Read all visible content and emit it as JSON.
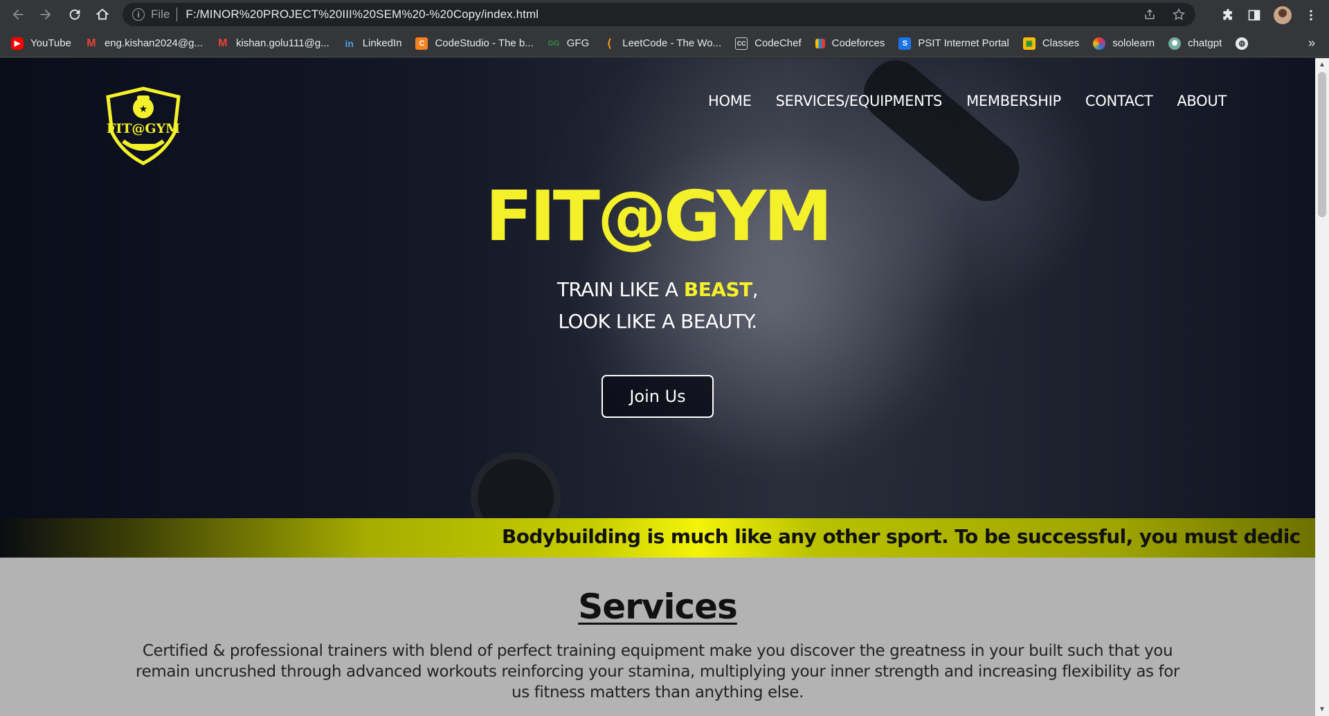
{
  "browser": {
    "file_label": "File",
    "url": "F:/MINOR%20PROJECT%20III%20SEM%20-%20Copy/index.html",
    "bookmarks": [
      {
        "label": "YouTube",
        "icon": "youtube-icon",
        "color": "#ff0000"
      },
      {
        "label": "eng.kishan2024@g...",
        "icon": "gmail-icon",
        "color": "#ea4335"
      },
      {
        "label": "kishan.golu111@g...",
        "icon": "gmail-icon",
        "color": "#ea4335"
      },
      {
        "label": "LinkedIn",
        "icon": "linkedin-icon",
        "color": "#0a66c2"
      },
      {
        "label": "CodeStudio - The b...",
        "icon": "codestudio-icon",
        "color": "#f5811f"
      },
      {
        "label": "GFG",
        "icon": "gfg-icon",
        "color": "#2f8d46"
      },
      {
        "label": "LeetCode - The Wo...",
        "icon": "leetcode-icon",
        "color": "#ffa116"
      },
      {
        "label": "CodeChef",
        "icon": "codechef-icon",
        "color": "#5b4638"
      },
      {
        "label": "Codeforces",
        "icon": "codeforces-icon",
        "color": "#1f8acb"
      },
      {
        "label": "PSIT Internet Portal",
        "icon": "psit-icon",
        "color": "#1a73e8"
      },
      {
        "label": "Classes",
        "icon": "classroom-icon",
        "color": "#fbbc04"
      },
      {
        "label": "sololearn",
        "icon": "sololearn-icon",
        "color": "#8e44ad"
      },
      {
        "label": "chatgpt",
        "icon": "chatgpt-icon",
        "color": "#74aa9c"
      }
    ]
  },
  "site": {
    "logo_text": "FIT@GYM",
    "nav": [
      "HOME",
      "SERVICES/EQUIPMENTS",
      "MEMBERSHIP",
      "CONTACT",
      "ABOUT"
    ],
    "hero": {
      "title": "FIT@GYM",
      "line1_prefix": "TRAIN LIKE A ",
      "line1_highlight": "BEAST",
      "line1_suffix": ",",
      "line2": "LOOK LIKE A BEAUTY.",
      "cta": "Join Us"
    },
    "marquee": "Bodybuilding is much like any other sport. To be successful, you must dedic",
    "services": {
      "heading": "Services",
      "description": "Certified & professional trainers with blend of perfect training equipment make you discover the greatness in your built such that you remain uncrushed through advanced workouts reinforcing your stamina, multiplying your inner strength and increasing flexibility as for us fitness matters than anything else."
    },
    "colors": {
      "accent": "#f4f12b",
      "services_bg": "#b3b3b3"
    }
  }
}
